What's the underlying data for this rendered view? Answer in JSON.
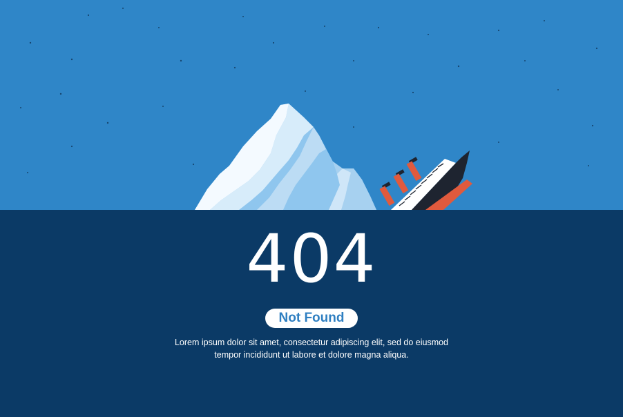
{
  "error": {
    "code": "404",
    "status_label": "Not Found",
    "description_line1": "Lorem ipsum dolor sit amet, consectetur adipiscing elit, sed do eiusmod",
    "description_line2": "tempor incididunt ut labore et dolore magna aliqua."
  },
  "colors": {
    "sky": "#2f86c8",
    "sea": "#0b3a66",
    "text": "#ffffff",
    "badge_text": "#2f7fc1"
  },
  "icons": [
    "star-icon",
    "iceberg-icon",
    "sinking-ship-icon"
  ]
}
